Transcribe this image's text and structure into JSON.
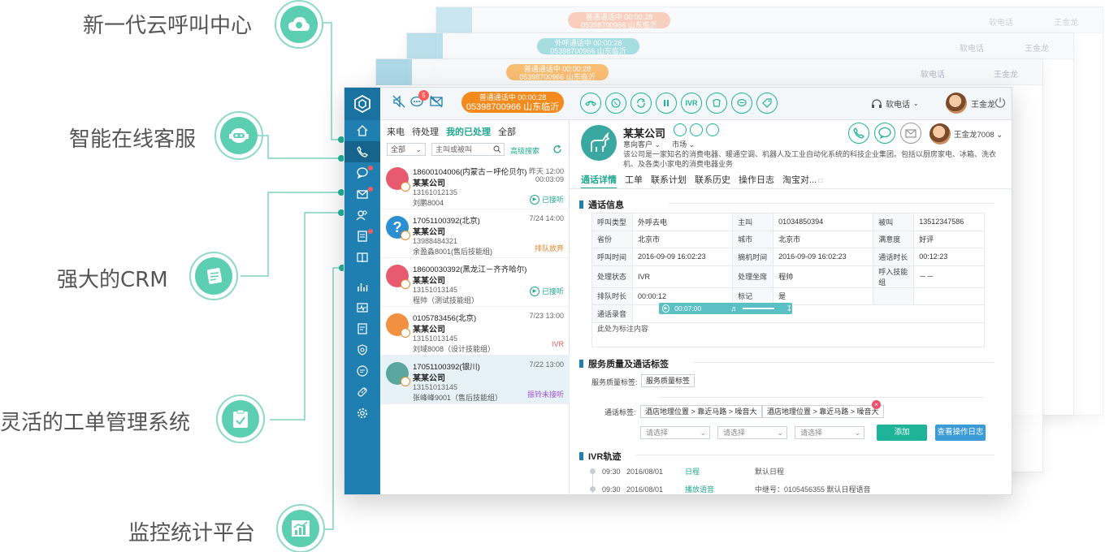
{
  "features": [
    {
      "label": "新一代云呼叫中心",
      "icon": "cloud-phone-icon"
    },
    {
      "label": "智能在线客服",
      "icon": "robot-agent-icon"
    },
    {
      "label": "强大的CRM",
      "icon": "crm-notes-icon"
    },
    {
      "label": "灵活的工单管理系统",
      "icon": "ticket-clipboard-icon"
    },
    {
      "label": "监控统计平台",
      "icon": "monitor-chart-icon"
    }
  ],
  "colors": {
    "brand": "#1f7fb0",
    "accent": "#1fb39a",
    "orange": "#f28a1e",
    "feature": "#5ccfb3"
  },
  "ghosts": [
    {
      "status": "普通通话中  00:00:28",
      "phone": "05398700966 山东临沂",
      "softphone": "软电话",
      "user": "王金龙"
    },
    {
      "status": "外呼通话中  00:00:28",
      "phone": "05398700966 山东临沂",
      "softphone": "软电话",
      "user": "王金龙"
    },
    {
      "status": "普通通话中  00:00:28",
      "phone": "05398700966 山东临沂",
      "softphone": "软电话",
      "user": "王金龙"
    }
  ],
  "topbar": {
    "badge": "5",
    "call_status": "普通通话中  00:00:28",
    "call_phone": "05398700966 山东临沂",
    "ivr": "IVR",
    "softphone": "软电话",
    "user": "王金龙"
  },
  "list": {
    "tabs": [
      "来电",
      "待处理",
      "我的已处理",
      "全部"
    ],
    "filter_value": "全部",
    "search_placeholder": "主叫或被叫",
    "advanced_search": "高级搜索",
    "items": [
      {
        "phone": "18600104006(内蒙古－呼伦贝尔)",
        "company": "某某公司",
        "number": "13161012135",
        "agent": "刘鹏8004",
        "time": "昨天 12:00",
        "duration": "00:03:09",
        "status": "已接听",
        "status_color": "#1fa88f",
        "avatar_color": "#e85a70"
      },
      {
        "phone": "17051100392(北京)",
        "company": "某某公司",
        "number": "13988484321",
        "agent": "余盈淼8001(售后技能组)",
        "time": "7/24 14:00",
        "duration": "",
        "status": "排队放弃",
        "status_color": "#e8862a",
        "avatar_color": "#2b8fd1"
      },
      {
        "phone": "18600030392(黑龙江－齐齐哈尔)",
        "company": "某某公司",
        "number": "13151013145",
        "agent": "程帅（测试技能组）",
        "time": "",
        "duration": "",
        "status": "已接听",
        "status_color": "#1fa88f",
        "avatar_color": "#e85a70"
      },
      {
        "phone": "0105783456(北京)",
        "company": "某某公司",
        "number": "13151013145",
        "agent": "刘域8008（设计技能组）",
        "time": "7/23 13:00",
        "duration": "",
        "status": "IVR",
        "status_color": "#e85a5a",
        "avatar_color": "#f09040"
      },
      {
        "phone": "17051100392(银川)",
        "company": "某某公司",
        "number": "13151013145",
        "agent": "张峰峰9001（售后技能组）",
        "time": "7/22 13:00",
        "duration": "",
        "status": "振铃未接听",
        "status_color": "#a24fd6",
        "avatar_color": "#5ba7a0"
      }
    ]
  },
  "detail": {
    "company": "某某公司",
    "intent": "意向客户",
    "source": "市场",
    "description": "该公司是一家知名的消费电器、暖通空调、机器人及工业自动化系统的科技企业集团。包括以厨房家电、冰箱、洗衣机、及各类小家电的消费电器业务",
    "agent": "王金龙7008",
    "tabs": [
      "通话详情",
      "工单",
      "联系计划",
      "联系历史",
      "操作日志",
      "淘宝对..."
    ],
    "section_call": "通话信息",
    "rows": [
      [
        [
          "呼叫类型",
          "外呼去电"
        ],
        [
          "主叫",
          "01034850394"
        ],
        [
          "被叫",
          "13512347586"
        ]
      ],
      [
        [
          "省份",
          "北京市"
        ],
        [
          "城市",
          "北京市"
        ],
        [
          "满意度",
          "好评"
        ]
      ],
      [
        [
          "呼叫时间",
          "2016-09-09 16:02:23"
        ],
        [
          "摘机时间",
          "2016-09-09 16:02:23"
        ],
        [
          "通话时长",
          "00:12:23"
        ]
      ],
      [
        [
          "处理状态",
          "IVR"
        ],
        [
          "处理坐席",
          "程帅"
        ],
        [
          "呼入技能组",
          "－－"
        ]
      ],
      [
        [
          "排队时长",
          "00:00:12"
        ],
        [
          "标记",
          "是"
        ],
        [
          "",
          ""
        ]
      ]
    ],
    "recording_label": "通话录音",
    "recording_time": "00:07:00",
    "note": "此处为标注内容",
    "section_quality": "服务质量及通话标签",
    "quality_label": "服务质量标签:",
    "quality_tag": "服务质量标签",
    "call_tag_label": "通话标签:",
    "call_tags": [
      "酒店地理位置 > 靠近马路 > 噪音大",
      "酒店地理位置 > 靠近马路 > 噪音大"
    ],
    "select_placeholder": "请选择",
    "add_button": "添加",
    "log_button": "查看操作日志",
    "section_ivr": "IVR轨迹",
    "ivr": [
      {
        "time": "09:30",
        "date": "2016/08/01",
        "type": "日程",
        "info": "默认日程"
      },
      {
        "time": "09:30",
        "date": "2016/08/01",
        "type": "播放语音",
        "info": "中继号：0105456355 默认日程语音"
      }
    ]
  }
}
